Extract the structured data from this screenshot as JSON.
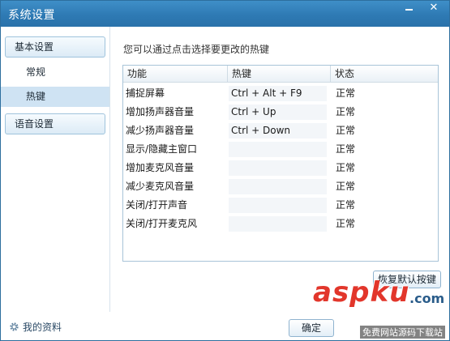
{
  "window": {
    "title": "系统设置",
    "minimize_glyph": "",
    "close_glyph": "✕"
  },
  "sidebar": {
    "groups": [
      {
        "label": "基本设置"
      },
      {
        "label": "语音设置"
      }
    ],
    "items": [
      {
        "label": "常规",
        "active": false
      },
      {
        "label": "热键",
        "active": true
      }
    ],
    "profile_label": "我的资料"
  },
  "main": {
    "hint": "您可以通过点击选择要更改的热键",
    "table": {
      "headers": [
        "功能",
        "热键",
        "状态"
      ],
      "rows": [
        {
          "function": "捕捉屏幕",
          "hotkey": "Ctrl + Alt + F9",
          "status": "正常"
        },
        {
          "function": "增加扬声器音量",
          "hotkey": "Ctrl + Up",
          "status": "正常"
        },
        {
          "function": "减少扬声器音量",
          "hotkey": "Ctrl + Down",
          "status": "正常"
        },
        {
          "function": "显示/隐藏主窗口",
          "hotkey": "",
          "status": "正常"
        },
        {
          "function": "增加麦克风音量",
          "hotkey": "",
          "status": "正常"
        },
        {
          "function": "减少麦克风音量",
          "hotkey": "",
          "status": "正常"
        },
        {
          "function": "关闭/打开声音",
          "hotkey": "",
          "status": "正常"
        },
        {
          "function": "关闭/打开麦克风",
          "hotkey": "",
          "status": "正常"
        }
      ]
    },
    "restore_button": "恢复默认按键",
    "ok_button": "确定"
  },
  "watermark": {
    "logo": "aspku",
    "tld": ".com",
    "subtitle": "免费网站源码下载站"
  },
  "colors": {
    "titlebar": "#2e7ab4",
    "active_item": "#cfe3f3",
    "watermark_red": "#e2362b"
  }
}
